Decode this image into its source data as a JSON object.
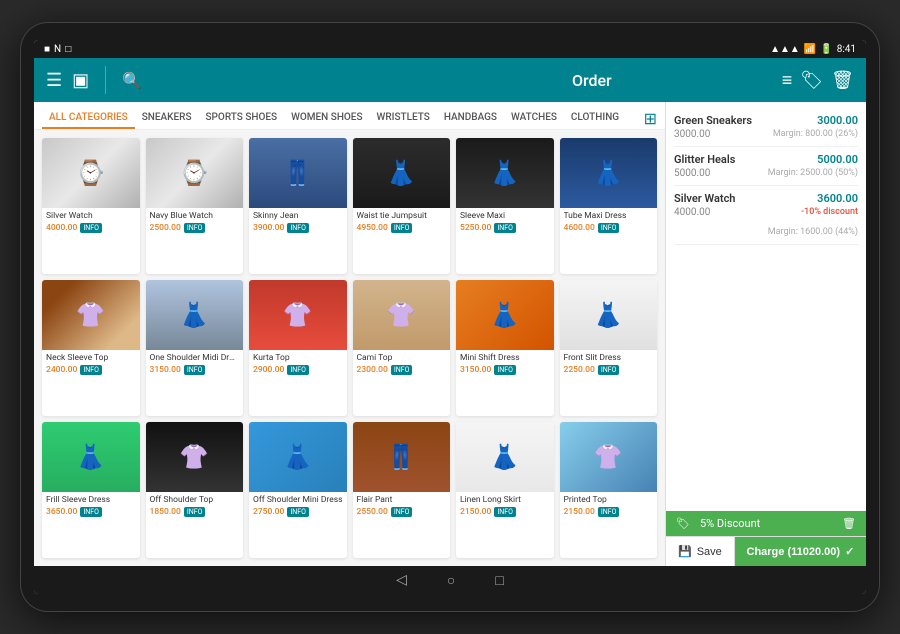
{
  "statusBar": {
    "leftIcons": [
      "■",
      "N",
      "□"
    ],
    "rightIcons": [
      "signal",
      "wifi",
      "battery"
    ],
    "time": "8:41"
  },
  "toolbar": {
    "menuIcon": "☰",
    "squareIcon": "▣",
    "searchIcon": "🔍",
    "orderTitle": "Order",
    "sortIcon": "≡",
    "tagIcon": "🏷",
    "trashIcon": "🗑"
  },
  "categories": [
    {
      "label": "ALL CATEGORIES",
      "active": true
    },
    {
      "label": "SNEAKERS",
      "active": false
    },
    {
      "label": "SPORTS SHOES",
      "active": false
    },
    {
      "label": "WOMEN SHOES",
      "active": false
    },
    {
      "label": "WRISTLETS",
      "active": false
    },
    {
      "label": "HANDBAGS",
      "active": false
    },
    {
      "label": "WATCHES",
      "active": false
    },
    {
      "label": "CLOTHING",
      "active": false
    }
  ],
  "products": [
    {
      "name": "Silver Watch",
      "price": "4000.00",
      "imageClass": "img-watch",
      "emoji": "⌚"
    },
    {
      "name": "Navy Blue Watch",
      "price": "2500.00",
      "imageClass": "img-watch",
      "emoji": "⌚"
    },
    {
      "name": "Skinny Jean",
      "price": "3900.00",
      "imageClass": "img-jeans",
      "emoji": "👖"
    },
    {
      "name": "Waist tie Jumpsuit",
      "price": "4950.00",
      "imageClass": "img-jumpsuit",
      "emoji": "👗"
    },
    {
      "name": "Sleeve Maxi",
      "price": "5250.00",
      "imageClass": "img-dress-black",
      "emoji": "👗"
    },
    {
      "name": "Tube Maxi Dress",
      "price": "4600.00",
      "imageClass": "img-dress-blue",
      "emoji": "👗"
    },
    {
      "name": "Neck Sleeve Top",
      "price": "2400.00",
      "imageClass": "img-floral",
      "emoji": "👚"
    },
    {
      "name": "One Shoulder Midi Dress",
      "price": "3150.00",
      "imageClass": "img-casual",
      "emoji": "👗"
    },
    {
      "name": "Kurta Top",
      "price": "2900.00",
      "imageClass": "img-red-dress",
      "emoji": "👚"
    },
    {
      "name": "Cami Top",
      "price": "2300.00",
      "imageClass": "img-tan",
      "emoji": "👚"
    },
    {
      "name": "Mini Shift Dress",
      "price": "3150.00",
      "imageClass": "img-orange",
      "emoji": "👗"
    },
    {
      "name": "Front Slit Dress",
      "price": "2250.00",
      "imageClass": "img-slit",
      "emoji": "👗"
    },
    {
      "name": "Frill Sleeve Dress",
      "price": "3650.00",
      "imageClass": "img-green",
      "emoji": "👗"
    },
    {
      "name": "Off Shoulder Top",
      "price": "1850.00",
      "imageClass": "img-black-off",
      "emoji": "👚"
    },
    {
      "name": "Off Shoulder Mini Dress",
      "price": "2750.00",
      "imageClass": "img-blue-off",
      "emoji": "👗"
    },
    {
      "name": "Flair Pant",
      "price": "2550.00",
      "imageClass": "img-brown-pant",
      "emoji": "👖"
    },
    {
      "name": "Linen Long Skirt",
      "price": "2150.00",
      "imageClass": "img-white-linen",
      "emoji": "👗"
    },
    {
      "name": "Printed Top",
      "price": "2150.00",
      "imageClass": "img-light-blue",
      "emoji": "👚"
    }
  ],
  "infoBadge": "INFO",
  "order": {
    "title": "Order",
    "items": [
      {
        "name": "Green Sneakers",
        "price": "3000.00",
        "subtotal": "3000.00",
        "margin": "Margin: 800.00 (26%)",
        "discount": null
      },
      {
        "name": "Glitter Heals",
        "price": "5000.00",
        "subtotal": "5000.00",
        "margin": "Margin: 2500.00 (50%)",
        "discount": null
      },
      {
        "name": "Silver Watch",
        "price": "3600.00",
        "subtotal": "4000.00",
        "discountText": "-10% discount",
        "margin": "Margin: 1600.00 (44%)",
        "discount": true
      }
    ],
    "discount": {
      "label": "5% Discount",
      "tagIcon": "🏷"
    },
    "saveLabel": "Save",
    "saveIcon": "💾",
    "chargeLabel": "Charge (11020.00)",
    "chargeIcon": "✓"
  }
}
